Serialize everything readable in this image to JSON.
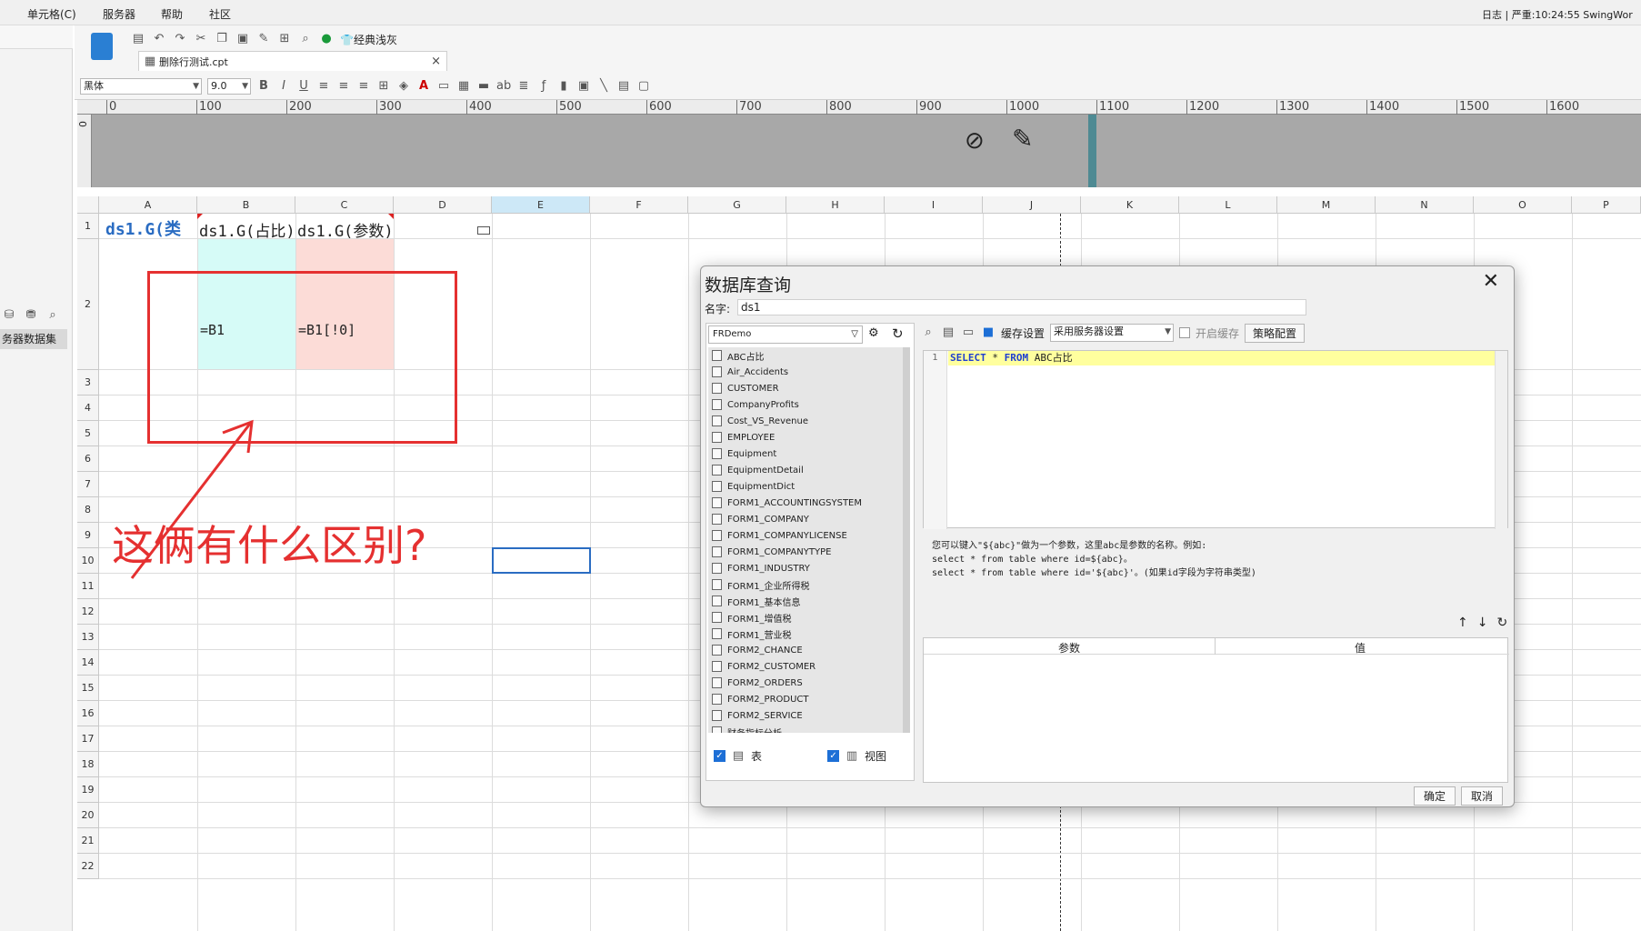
{
  "menubar": {
    "items": [
      "单元格(C)",
      "服务器",
      "帮助",
      "社区"
    ],
    "right_text": "日志 | 严重:10:24:55 SwingWor"
  },
  "left_pane": {
    "dataset_label": "务器数据集"
  },
  "toolbar": {
    "theme_label": "经典浅灰",
    "tab_label": "删除行测试.cpt",
    "font_name": "黑体",
    "font_size": "9.0"
  },
  "ruler": {
    "ticks": [
      "0",
      "100",
      "200",
      "300",
      "400",
      "500",
      "600",
      "700",
      "800",
      "900",
      "1000",
      "1100",
      "1200",
      "1300",
      "1400",
      "1500",
      "1600"
    ],
    "vertical_zero": "0"
  },
  "sheet": {
    "columns": [
      "A",
      "B",
      "C",
      "D",
      "E",
      "F",
      "G",
      "H",
      "I",
      "J",
      "K",
      "L",
      "M",
      "N",
      "O",
      "P"
    ],
    "rows": [
      "1",
      "2",
      "3",
      "4",
      "5",
      "6",
      "7",
      "8",
      "9",
      "10",
      "11",
      "12",
      "13",
      "14",
      "15",
      "16",
      "17",
      "18",
      "19",
      "20",
      "21",
      "22"
    ],
    "a1": "ds1.G(类",
    "b1": "ds1.G(占比)",
    "c1": "ds1.G(参数)",
    "b2": "=B1",
    "c2": "=B1[!0]",
    "annotation": "这俩有什么区别?",
    "cell_b2_color": "#d6fbf7",
    "cell_c2_color": "#fcdcd7"
  },
  "dialog": {
    "title": "数据库查询",
    "name_label": "名字:",
    "name_value": "ds1",
    "datasource": "FRDemo",
    "tables": [
      "ABC占比",
      "Air_Accidents",
      "CUSTOMER",
      "CompanyProfits",
      "Cost_VS_Revenue",
      "EMPLOYEE",
      "Equipment",
      "EquipmentDetail",
      "EquipmentDict",
      "FORM1_ACCOUNTINGSYSTEM",
      "FORM1_COMPANY",
      "FORM1_COMPANYLICENSE",
      "FORM1_COMPANYTYPE",
      "FORM1_INDUSTRY",
      "FORM1_企业所得税",
      "FORM1_基本信息",
      "FORM1_增值税",
      "FORM1_营业税",
      "FORM2_CHANCE",
      "FORM2_CUSTOMER",
      "FORM2_ORDERS",
      "FORM2_PRODUCT",
      "FORM2_SERVICE",
      "财务指标分析"
    ],
    "table_check_label": "表",
    "view_check_label": "视图",
    "cache_label": "缓存设置",
    "server_setting": "采用服务器设置",
    "enable_cache_label": "开启缓存",
    "strategy_button": "策略配置",
    "sql_line_number": "1",
    "sql_kw1": "SELECT",
    "sql_star": "*",
    "sql_kw2": "FROM",
    "sql_table": "ABC占比",
    "hint_line1": "您可以键入\"${abc}\"做为一个参数，这里abc是参数的名称。例如:",
    "hint_line2": "select * from table where id=${abc}。",
    "hint_line3": "select * from table where id='${abc}'。(如果id字段为字符串类型)",
    "param_col": "参数",
    "value_col": "值",
    "ok_button": "确定",
    "cancel_button": "取消"
  }
}
